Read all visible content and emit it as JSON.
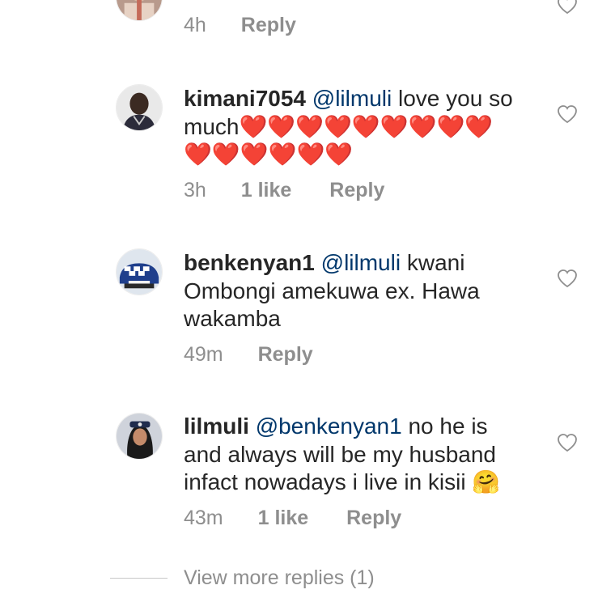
{
  "comments": [
    {
      "meta": {
        "time": "4h",
        "reply": "Reply"
      }
    },
    {
      "username": "kimani7054",
      "mention": "@lilmuli",
      "text_line1": " love you so",
      "text_line2": "much",
      "hearts_line2": "❤️❤️❤️❤️❤️❤️❤️❤️❤️",
      "hearts_line3": "❤️❤️❤️❤️❤️❤️",
      "meta": {
        "time": "3h",
        "likes": "1 like",
        "reply": "Reply"
      }
    },
    {
      "username": "benkenyan1",
      "mention": "@lilmuli",
      "text": " kwani Ombongi amekuwa ex. Hawa wakamba",
      "meta": {
        "time": "49m",
        "reply": "Reply"
      }
    },
    {
      "username": "lilmuli",
      "mention": "@benkenyan1",
      "text": " no he is and always will be my husband infact nowadays i live in kisii 🤗",
      "meta": {
        "time": "43m",
        "likes": "1 like",
        "reply": "Reply"
      }
    }
  ],
  "view_more": "View more replies (1)",
  "icons": {
    "like": "heart-outline-icon"
  },
  "colors": {
    "text": "#262626",
    "mention": "#00376b",
    "meta": "#8e8e8e",
    "heart": "#e0232e"
  }
}
